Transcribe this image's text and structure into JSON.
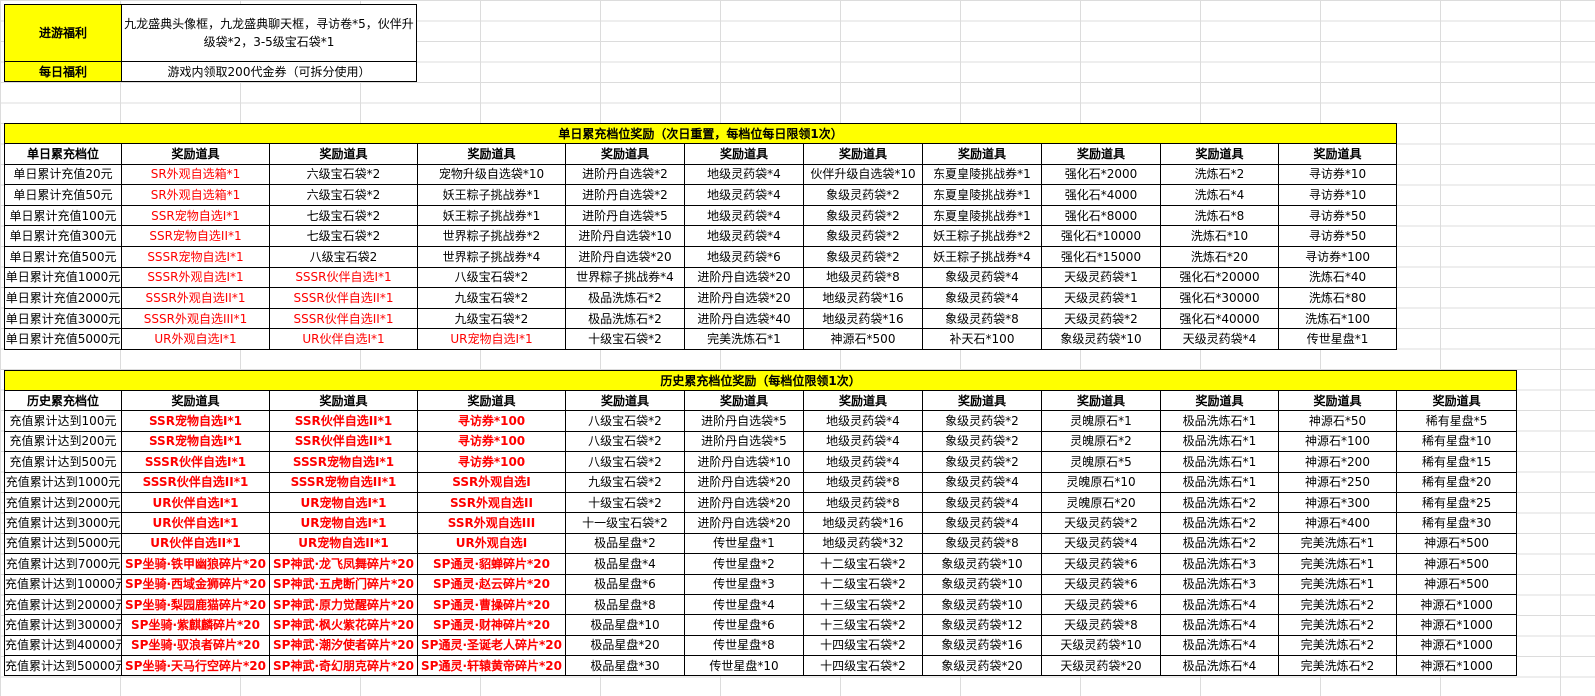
{
  "top": {
    "rows": [
      {
        "label": "进游福利",
        "value": "九龙盛典头像框，九龙盛典聊天框，寻访卷*5，伙伴升级袋*2，3-5级宝石袋*1"
      },
      {
        "label": "每日福利",
        "value": "游戏内领取200代金券（可拆分使用）"
      }
    ]
  },
  "daily": {
    "title": "单日累充档位奖励（次日重置，每档位每日限领1次）",
    "headers": [
      "单日累充档位",
      "奖励道具",
      "奖励道具",
      "奖励道具",
      "奖励道具",
      "奖励道具",
      "奖励道具",
      "奖励道具",
      "奖励道具",
      "奖励道具",
      "奖励道具",
      "奖励道具"
    ],
    "rows": [
      [
        "单日累计充值20元",
        "SR外观自选箱*1",
        "六级宝石袋*2",
        "宠物升级自选袋*10",
        "进阶丹自选袋*2",
        "地级灵药袋*4",
        "伙伴升级自选袋*10",
        "东夏皇陵挑战券*1",
        "强化石*2000",
        "洗炼石*2",
        "寻访券*10"
      ],
      [
        "单日累计充值50元",
        "SR外观自选箱*1",
        "六级宝石袋*2",
        "妖王粽子挑战券*1",
        "进阶丹自选袋*2",
        "地级灵药袋*4",
        "象级灵药袋*2",
        "东夏皇陵挑战券*1",
        "强化石*4000",
        "洗炼石*4",
        "寻访券*10"
      ],
      [
        "单日累计充值100元",
        "SSR宠物自选I*1",
        "七级宝石袋*2",
        "妖王粽子挑战券*1",
        "进阶丹自选袋*5",
        "地级灵药袋*4",
        "象级灵药袋*2",
        "东夏皇陵挑战券*1",
        "强化石*8000",
        "洗炼石*8",
        "寻访券*50"
      ],
      [
        "单日累计充值300元",
        "SSR宠物自选II*1",
        "七级宝石袋*2",
        "世界粽子挑战券*2",
        "进阶丹自选袋*10",
        "地级灵药袋*4",
        "象级灵药袋*2",
        "妖王粽子挑战券*2",
        "强化石*10000",
        "洗炼石*10",
        "寻访券*50"
      ],
      [
        "单日累计充值500元",
        "SSSR宠物自选I*1",
        "八级宝石袋2",
        "世界粽子挑战券*4",
        "进阶丹自选袋*20",
        "地级灵药袋*6",
        "象级灵药袋*2",
        "妖王粽子挑战券*4",
        "强化石*15000",
        "洗炼石*20",
        "寻访券*100"
      ],
      [
        "单日累计充值1000元",
        "SSSR外观自选I*1",
        "SSSR伙伴自选I*1",
        "八级宝石袋*2",
        "世界粽子挑战券*4",
        "进阶丹自选袋*20",
        "地级灵药袋*8",
        "象级灵药袋*4",
        "天级灵药袋*1",
        "强化石*20000",
        "洗炼石*40"
      ],
      [
        "单日累计充值2000元",
        "SSSR外观自选II*1",
        "SSSR伙伴自选II*1",
        "九级宝石袋*2",
        "极品洗炼石*2",
        "进阶丹自选袋*20",
        "地级灵药袋*16",
        "象级灵药袋*4",
        "天级灵药袋*1",
        "强化石*30000",
        "洗炼石*80"
      ],
      [
        "单日累计充值3000元",
        "SSSR外观自选III*1",
        "SSSR伙伴自选II*1",
        "九级宝石袋*2",
        "极品洗炼石*2",
        "进阶丹自选袋*40",
        "地级灵药袋*16",
        "象级灵药袋*8",
        "天级灵药袋*2",
        "强化石*40000",
        "洗炼石*100"
      ],
      [
        "单日累计充值5000元",
        "UR外观自选I*1",
        "UR伙伴自选I*1",
        "UR宠物自选I*1",
        "十级宝石袋*2",
        "完美洗炼石*1",
        "神源石*500",
        "补天石*100",
        "象级灵药袋*10",
        "天级灵药袋*4",
        "传世星盘*1"
      ]
    ]
  },
  "history": {
    "title": "历史累充档位奖励（每档位限领1次）",
    "headers": [
      "历史累充档位",
      "奖励道具",
      "奖励道具",
      "奖励道具",
      "奖励道具",
      "奖励道具",
      "奖励道具",
      "奖励道具",
      "奖励道具",
      "奖励道具",
      "奖励道具",
      "奖励道具",
      "奖励道具"
    ],
    "rows": [
      [
        "充值累计达到100元",
        "SSR宠物自选I*1",
        "SSR伙伴自选II*1",
        "寻访券*100",
        "八级宝石袋*2",
        "进阶丹自选袋*5",
        "地级灵药袋*4",
        "象级灵药袋*2",
        "灵魄原石*1",
        "极品洗炼石*1",
        "神源石*50",
        "稀有星盘*5"
      ],
      [
        "充值累计达到200元",
        "SSR宠物自选I*1",
        "SSR伙伴自选II*1",
        "寻访券*100",
        "八级宝石袋*2",
        "进阶丹自选袋*5",
        "地级灵药袋*4",
        "象级灵药袋*2",
        "灵魄原石*2",
        "极品洗炼石*1",
        "神源石*100",
        "稀有星盘*10"
      ],
      [
        "充值累计达到500元",
        "SSSR伙伴自选I*1",
        "SSSR宠物自选I*1",
        "寻访券*100",
        "八级宝石袋*2",
        "进阶丹自选袋*10",
        "地级灵药袋*4",
        "象级灵药袋*2",
        "灵魄原石*5",
        "极品洗炼石*1",
        "神源石*200",
        "稀有星盘*15"
      ],
      [
        "充值累计达到1000元",
        "SSSR伙伴自选II*1",
        "SSSR宠物自选II*1",
        "SSR外观自选I",
        "九级宝石袋*2",
        "进阶丹自选袋*20",
        "地级灵药袋*8",
        "象级灵药袋*4",
        "灵魄原石*10",
        "极品洗炼石*1",
        "神源石*250",
        "稀有星盘*20"
      ],
      [
        "充值累计达到2000元",
        "UR伙伴自选I*1",
        "UR宠物自选I*1",
        "SSR外观自选II",
        "十级宝石袋*2",
        "进阶丹自选袋*20",
        "地级灵药袋*8",
        "象级灵药袋*4",
        "灵魄原石*20",
        "极品洗炼石*2",
        "神源石*300",
        "稀有星盘*25"
      ],
      [
        "充值累计达到3000元",
        "UR伙伴自选I*1",
        "UR宠物自选I*1",
        "SSR外观自选III",
        "十一级宝石袋*2",
        "进阶丹自选袋*20",
        "地级灵药袋*16",
        "象级灵药袋*4",
        "天级灵药袋*2",
        "极品洗炼石*2",
        "神源石*400",
        "稀有星盘*30"
      ],
      [
        "充值累计达到5000元",
        "UR伙伴自选II*1",
        "UR宠物自选II*1",
        "UR外观自选I",
        "极品星盘*2",
        "传世星盘*1",
        "地级灵药袋*32",
        "象级灵药袋*8",
        "天级灵药袋*4",
        "极品洗炼石*2",
        "完美洗炼石*1",
        "神源石*500"
      ],
      [
        "充值累计达到7000元",
        "SP坐骑·铁甲幽狼碎片*20",
        "SP神武·龙飞凤舞碎片*20",
        "SP通灵·貂蝉碎片*20",
        "极品星盘*4",
        "传世星盘*2",
        "十二级宝石袋*2",
        "象级灵药袋*10",
        "天级灵药袋*6",
        "极品洗炼石*3",
        "完美洗炼石*1",
        "神源石*500"
      ],
      [
        "充值累计达到10000元",
        "SP坐骑·西域金狮碎片*20",
        "SP神武·五虎断门碎片*20",
        "SP通灵·赵云碎片*20",
        "极品星盘*6",
        "传世星盘*3",
        "十二级宝石袋*2",
        "象级灵药袋*10",
        "天级灵药袋*6",
        "极品洗炼石*3",
        "完美洗炼石*1",
        "神源石*500"
      ],
      [
        "充值累计达到20000元",
        "SP坐骑·梨园鹿猫碎片*20",
        "SP神武·原力觉醒碎片*20",
        "SP通灵·曹操碎片*20",
        "极品星盘*8",
        "传世星盘*4",
        "十三级宝石袋*2",
        "象级灵药袋*10",
        "天级灵药袋*6",
        "极品洗炼石*4",
        "完美洗炼石*2",
        "神源石*1000"
      ],
      [
        "充值累计达到30000元",
        "SP坐骑·紫麒麟碎片*20",
        "SP神武·枫火紫花碎片*20",
        "SP通灵·财神碎片*20",
        "极品星盘*10",
        "传世星盘*6",
        "十三级宝石袋*2",
        "象级灵药袋*12",
        "天级灵药袋*8",
        "极品洗炼石*4",
        "完美洗炼石*2",
        "神源石*1000"
      ],
      [
        "充值累计达到40000元",
        "SP坐骑·驭浪者碎片*20",
        "SP神武·潮汐使者碎片*20",
        "SP通灵·圣诞老人碎片*20",
        "极品星盘*20",
        "传世星盘*8",
        "十四级宝石袋*2",
        "象级灵药袋*16",
        "天级灵药袋*10",
        "极品洗炼石*4",
        "完美洗炼石*2",
        "神源石*1000"
      ],
      [
        "充值累计达到50000元",
        "SP坐骑·天马行空碎片*20",
        "SP神武·奇幻朋克碎片*20",
        "SP通灵·轩辕黄帝碎片*20",
        "极品星盘*30",
        "传世星盘*10",
        "十四级宝石袋*2",
        "象级灵药袋*20",
        "天级灵药袋*20",
        "极品洗炼石*4",
        "完美洗炼石*2",
        "神源石*1000"
      ]
    ]
  },
  "colors": {
    "header_fill": "#ffff00",
    "accent_text": "#ff0000"
  }
}
